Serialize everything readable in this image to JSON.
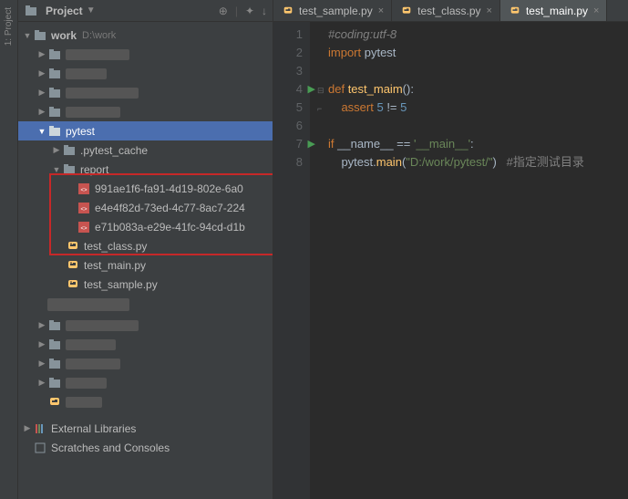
{
  "sidebar": {
    "title": "Project",
    "tools": [
      "⊕",
      "↕",
      "✦",
      "↓"
    ],
    "root": {
      "name": "work",
      "path": "D:\\work"
    },
    "pytest": "pytest",
    "pytest_cache": ".pytest_cache",
    "report": "report",
    "report_files": [
      "991ae1f6-fa91-4d19-802e-6a0",
      "e4e4f82d-73ed-4c77-8ac7-224",
      "e71b083a-e29e-41fc-94cd-d1b"
    ],
    "py_files": [
      "test_class.py",
      "test_main.py",
      "test_sample.py"
    ],
    "external": "External Libraries",
    "scratches": "Scratches and Consoles"
  },
  "tabs": [
    {
      "label": "test_sample.py",
      "active": false
    },
    {
      "label": "test_class.py",
      "active": false
    },
    {
      "label": "test_main.py",
      "active": true
    }
  ],
  "code": {
    "l1_comment": "#coding:utf-8",
    "l2a": "import",
    "l2b": " pytest",
    "l4a": "def ",
    "l4b": "test_maim",
    "l4c": "():",
    "l5a": "    ",
    "l5b": "assert ",
    "l5c": "5",
    "l5d": " != ",
    "l5e": "5",
    "l7a": "if ",
    "l7b": "__name__ == ",
    "l7c": "'__main__'",
    "l7d": ":",
    "l8a": "    pytest.",
    "l8b": "main",
    "l8c": "(",
    "l8d": "\"D:/work/pytest/\"",
    "l8e": ")   ",
    "l8_comment": "#指定测试目录"
  },
  "line_numbers": [
    "1",
    "2",
    "3",
    "4",
    "5",
    "6",
    "7",
    "8"
  ]
}
